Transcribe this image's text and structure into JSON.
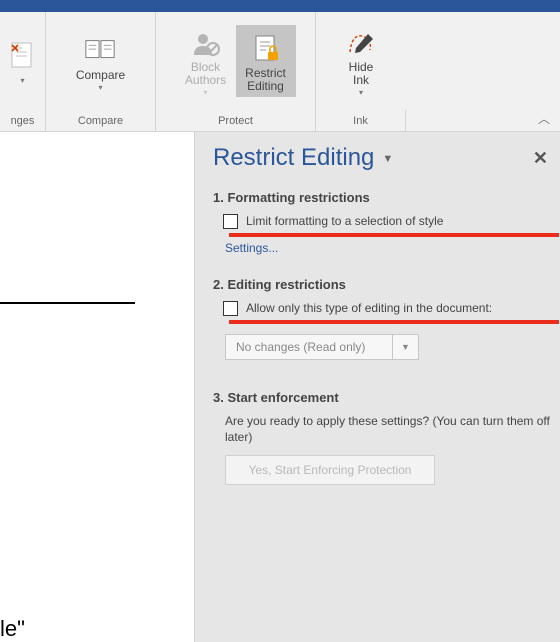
{
  "ribbon": {
    "accept": {
      "label": ""
    },
    "compare": {
      "label": "Compare"
    },
    "block": {
      "label": "Block\nAuthors"
    },
    "restrict": {
      "label": "Restrict\nEditing"
    },
    "hide": {
      "label": "Hide\nInk"
    }
  },
  "groups": {
    "changes": "nges",
    "compare": "Compare",
    "protect": "Protect",
    "ink": "Ink"
  },
  "doc": {
    "bottom_text": "le\""
  },
  "pane": {
    "title": "Restrict Editing",
    "sec1": {
      "head": "1. Formatting restrictions",
      "opt": "Limit formatting to a selection of style",
      "link": "Settings..."
    },
    "sec2": {
      "head": "2. Editing restrictions",
      "opt": "Allow only this type of editing in the document:",
      "dd": "No changes (Read only)"
    },
    "sec3": {
      "head": "3. Start enforcement",
      "desc": "Are you ready to apply these settings? (You can turn them off later)",
      "btn": "Yes, Start Enforcing Protection"
    }
  }
}
